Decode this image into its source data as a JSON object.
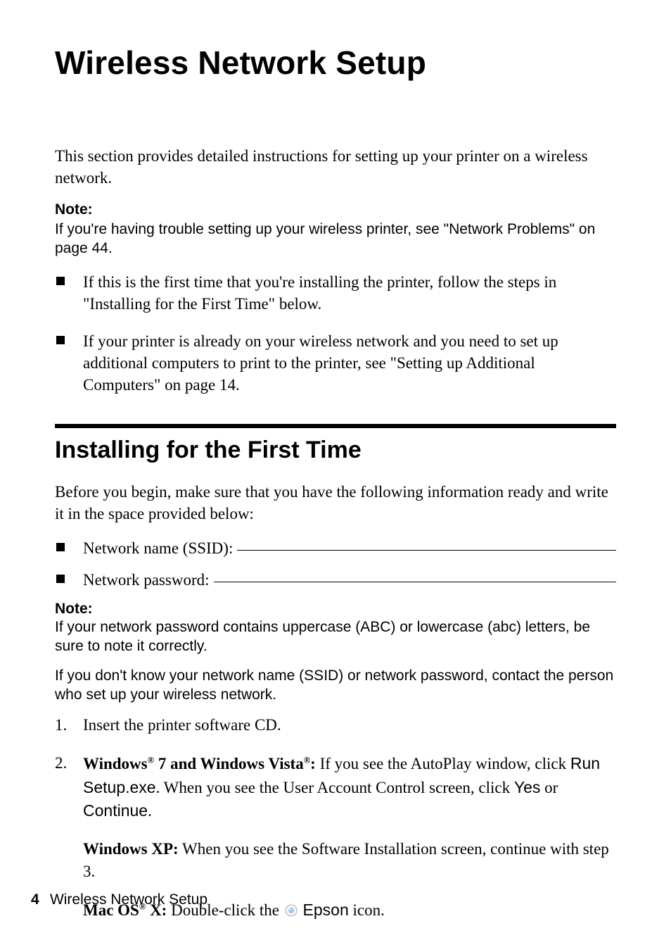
{
  "title": "Wireless Network Setup",
  "intro": "This section provides detailed instructions for setting up your printer on a wireless network.",
  "note1_label": "Note:",
  "note1_body": "If you're having trouble setting up your wireless printer, see \"Network Problems\" on page 44.",
  "bullets": [
    "If this is the first time that you're installing the printer, follow the steps in \"Installing for the First Time\" below.",
    "If your printer is already on your wireless network and you need to set up additional computers to print to the printer, see \"Setting up Additional Computers\" on page 14."
  ],
  "section_title": "Installing for the First Time",
  "before_begin": "Before you begin, make sure that you have the following information ready and write it in the space provided below:",
  "fields": {
    "ssid_label": "Network name (SSID): ",
    "password_label": "Network password: "
  },
  "note2_label": "Note:",
  "note2_p1_prefix": "If your network password contains uppercase (",
  "note2_p1_abc_upper": "ABC",
  "note2_p1_mid": ") or lowercase (",
  "note2_p1_abc_lower": "abc",
  "note2_p1_suffix": ") letters, be sure to note it correctly.",
  "note2_p2": "If you don't know your network name (SSID) or network password, contact the person who set up your wireless network.",
  "step1": "Insert the printer software CD.",
  "step2": {
    "win7_label_a": "Windows",
    "win7_label_b": " 7 and Windows Vista",
    "win7_label_c": ":",
    "win7_body_a": " If you see the AutoPlay window, click ",
    "run_setup": "Run Setup.exe",
    "win7_body_b": ". When you see the User Account Control screen, click ",
    "yes": "Yes",
    "or": " or ",
    "continue": "Continue",
    "period": ".",
    "xp_label": "Windows XP:",
    "xp_body": " When you see the Software Installation screen, continue with step 3.",
    "mac_label_a": "Mac OS",
    "mac_label_b": " X:",
    "mac_body_a": " Double-click the ",
    "epson": "Epson",
    "mac_body_b": " icon."
  },
  "footer": {
    "page": "4",
    "chapter": "Wireless Network Setup"
  }
}
